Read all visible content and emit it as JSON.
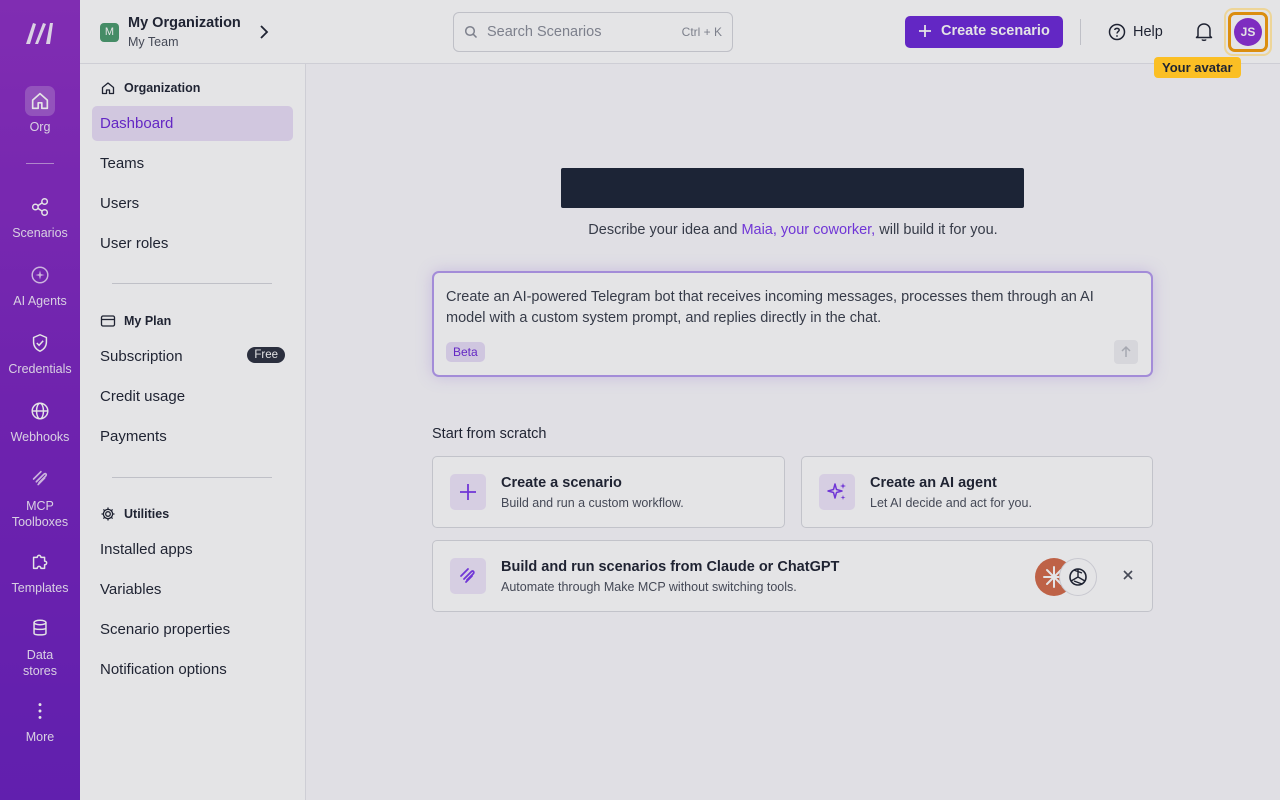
{
  "rail": {
    "items": [
      {
        "label": "Org"
      },
      {
        "label": "Scenarios"
      },
      {
        "label": "AI Agents"
      },
      {
        "label": "Credentials"
      },
      {
        "label": "Webhooks"
      },
      {
        "label": "MCP Toolboxes"
      },
      {
        "label": "Templates"
      },
      {
        "label": "Data stores"
      },
      {
        "label": "More"
      }
    ]
  },
  "header": {
    "org_initial": "M",
    "org_name": "My Organization",
    "team_name": "My Team",
    "search_placeholder": "Search Scenarios",
    "search_shortcut": "Ctrl + K",
    "create_label": "Create scenario",
    "help_label": "Help",
    "avatar_initials": "JS",
    "avatar_tooltip": "Your avatar"
  },
  "sidebar": {
    "sections": [
      {
        "title": "Organization",
        "items": [
          {
            "label": "Dashboard"
          },
          {
            "label": "Teams"
          },
          {
            "label": "Users"
          },
          {
            "label": "User roles"
          }
        ]
      },
      {
        "title": "My Plan",
        "items": [
          {
            "label": "Subscription",
            "badge": "Free"
          },
          {
            "label": "Credit usage"
          },
          {
            "label": "Payments"
          }
        ]
      },
      {
        "title": "Utilities",
        "items": [
          {
            "label": "Installed apps"
          },
          {
            "label": "Variables"
          },
          {
            "label": "Scenario properties"
          },
          {
            "label": "Notification options"
          }
        ]
      }
    ]
  },
  "main": {
    "subtitle_pre": "Describe your idea and ",
    "subtitle_link": "Maia, your coworker,",
    "subtitle_post": " will build it for you.",
    "prompt_text": "Create an AI-powered Telegram bot that receives incoming messages, processes them through an AI model with a custom system prompt, and replies directly in the chat.",
    "beta_label": "Beta",
    "scratch_title": "Start from scratch",
    "cards": [
      {
        "title": "Create a scenario",
        "subtitle": "Build and run a custom workflow."
      },
      {
        "title": "Create an AI agent",
        "subtitle": "Let AI decide and act for you."
      }
    ],
    "mcp_card": {
      "title": "Build and run scenarios from Claude or ChatGPT",
      "subtitle": "Automate through Make MCP without switching tools."
    }
  },
  "colors": {
    "accent": "#6d28d9",
    "rail": "#7a24c0",
    "highlight": "#f59e0b"
  }
}
